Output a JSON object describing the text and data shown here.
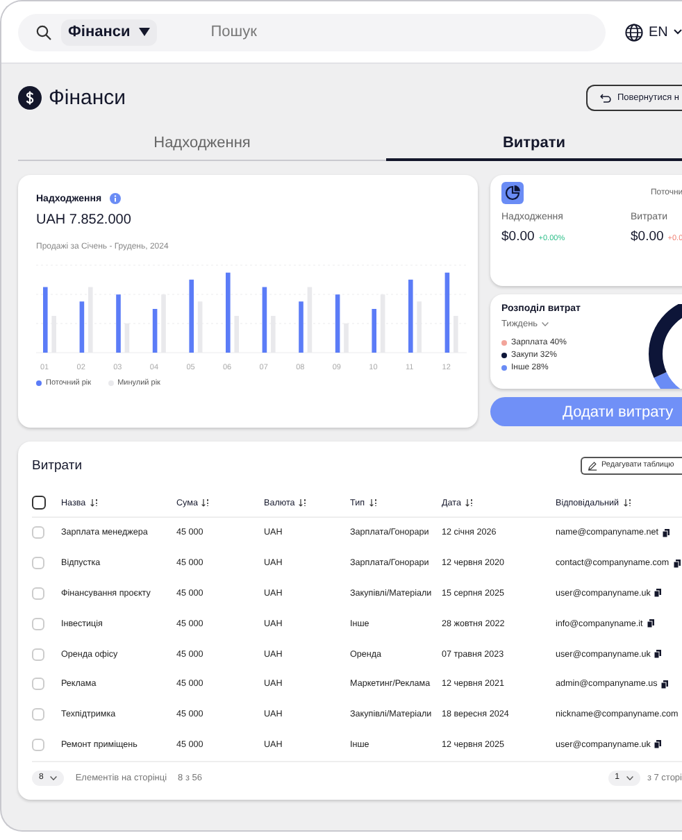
{
  "topbar": {
    "section": "Фінанси",
    "search": {
      "placeholder": "Пошук"
    },
    "language": "EN"
  },
  "page": {
    "title": "Фінанси",
    "back_button": "Повернутися н"
  },
  "tabs": [
    {
      "label": "Надходження",
      "selected": false
    },
    {
      "label": "Витрати",
      "selected": true
    }
  ],
  "income_card": {
    "title": "Надходження",
    "amount": "UAH 7.852.000",
    "subtitle": "Продажі за Січень - Грудень, 2024",
    "months": [
      "01",
      "02",
      "03",
      "04",
      "05",
      "06",
      "07",
      "08",
      "09",
      "10",
      "11",
      "12"
    ],
    "legend": [
      {
        "label": "Поточний рік",
        "color": "#5b7cf7"
      },
      {
        "label": "Минулий рік",
        "color": "#e9e9ec"
      }
    ]
  },
  "summary_card": {
    "period": "Поточни",
    "metrics": [
      {
        "label": "Надходження",
        "value": "$0.00",
        "change": "+0.00%",
        "positive": true
      },
      {
        "label": "Витрати",
        "value": "$0.00",
        "change": "+0.0",
        "positive": false
      }
    ]
  },
  "distribution_card": {
    "title": "Розподіл витрат",
    "period": "Тиждень",
    "legend": [
      {
        "label": "Зарплата 40%",
        "color": "#f2a49a"
      },
      {
        "label": "Закупи 32%",
        "color": "#0d1538"
      },
      {
        "label": "Інше 28%",
        "color": "#6a8cf5"
      }
    ]
  },
  "add_button": "Додати витрату",
  "table": {
    "title": "Витрати",
    "edit_button": "Редагувати таблицю",
    "all_selected": false,
    "columns": [
      "Назва",
      "Сума",
      "Валюта",
      "Тип",
      "Дата",
      "Відповідальний"
    ],
    "rows": [
      {
        "checked": false,
        "cells": [
          "Зарплата менеджера",
          "45 000",
          "UAH",
          "Зарплата/Гонорари",
          "12 січня 2026",
          "name@companyname.net"
        ],
        "copy": true
      },
      {
        "checked": false,
        "cells": [
          "Відпустка",
          "45 000",
          "UAH",
          "Зарплата/Гонорари",
          "12 червня 2020",
          "contact@companyname.com"
        ],
        "copy": true
      },
      {
        "checked": false,
        "cells": [
          "Фінансування проєкту",
          "45 000",
          "UAH",
          "Закупівлі/Матеріали",
          "15 серпня 2025",
          "user@companyname.uk"
        ],
        "copy": true
      },
      {
        "checked": false,
        "cells": [
          "Інвестиція",
          "45 000",
          "UAH",
          "Інше",
          "28 жовтня 2022",
          "info@companyname.it"
        ],
        "copy": true
      },
      {
        "checked": false,
        "cells": [
          "Оренда офісу",
          "45 000",
          "UAH",
          "Оренда",
          "07 травня 2023",
          "user@companyname.uk"
        ],
        "copy": true
      },
      {
        "checked": false,
        "cells": [
          "Реклама",
          "45 000",
          "UAH",
          "Маркетинг/Реклама",
          "12 червня 2021",
          "admin@companyname.us"
        ],
        "copy": true
      },
      {
        "checked": false,
        "cells": [
          "Техпідтримка",
          "45 000",
          "UAH",
          "Закупівлі/Матеріали",
          "18 вересня 2024",
          "nickname@companyname.com"
        ],
        "copy": false
      },
      {
        "checked": false,
        "cells": [
          "Ремонт приміщень",
          "45 000",
          "UAH",
          "Інше",
          "12 червня 2025",
          "user@companyname.uk"
        ],
        "copy": true
      }
    ],
    "footer": {
      "page_size": "8",
      "page_size_label": "Елементів на сторінці",
      "range": "8 з 56",
      "page": "1",
      "pages": "з 7 сторі"
    }
  }
}
